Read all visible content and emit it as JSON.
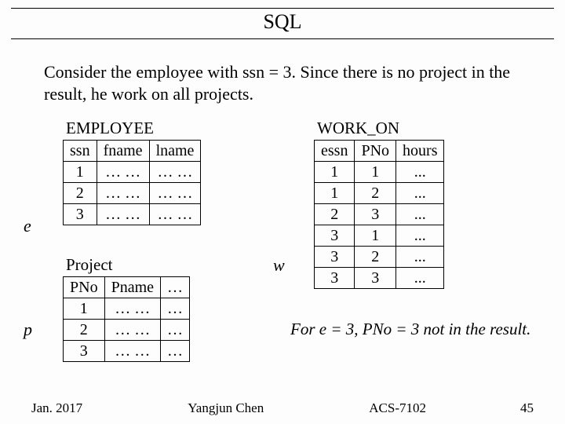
{
  "header": {
    "title": "SQL"
  },
  "intro": "Consider the employee with ssn = 3. Since there is no project in the result, he work on all projects.",
  "labels": {
    "e": "e",
    "p": "p",
    "w": "w"
  },
  "employee": {
    "title": "EMPLOYEE",
    "cols": [
      "ssn",
      "fname",
      "lname"
    ],
    "rows": [
      [
        "1",
        "… …",
        "… …"
      ],
      [
        "2",
        "… …",
        "… …"
      ],
      [
        "3",
        "… …",
        "… …"
      ]
    ]
  },
  "project": {
    "title": "Project",
    "cols": [
      "PNo",
      "Pname",
      "…"
    ],
    "rows": [
      [
        "1",
        "… …",
        "…"
      ],
      [
        "2",
        "… …",
        "…"
      ],
      [
        "3",
        "… …",
        "…"
      ]
    ]
  },
  "work_on": {
    "title": "WORK_ON",
    "cols": [
      "essn",
      "PNo",
      "hours"
    ],
    "rows": [
      [
        "1",
        "1",
        "..."
      ],
      [
        "1",
        "2",
        "..."
      ],
      [
        "2",
        "3",
        "..."
      ],
      [
        "3",
        "1",
        "..."
      ],
      [
        "3",
        "2",
        "..."
      ],
      [
        "3",
        "3",
        "..."
      ]
    ]
  },
  "note": "For e = 3, PNo = 3 not in the result.",
  "footer": {
    "left": "Jan. 2017",
    "center": "Yangjun Chen",
    "right_course": "ACS-7102",
    "right_page": "45"
  }
}
